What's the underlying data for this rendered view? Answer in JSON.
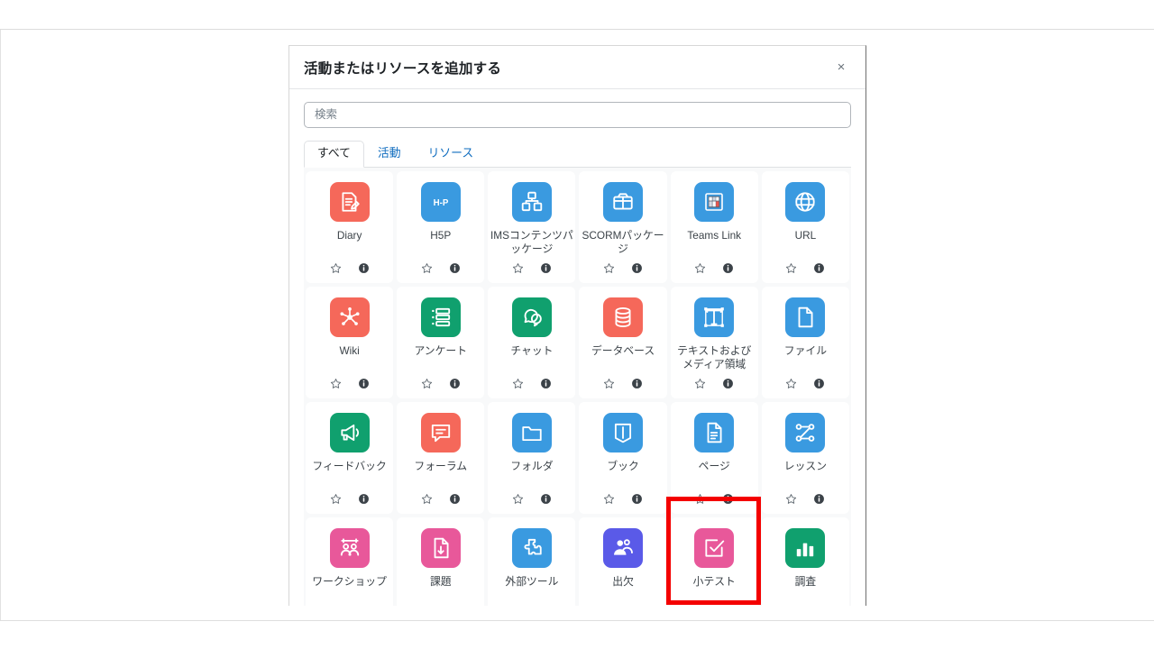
{
  "modal": {
    "title": "活動またはリソースを追加する",
    "close_label": "×",
    "close_icon": "close-icon"
  },
  "search": {
    "placeholder": "検索",
    "value": ""
  },
  "tabs": [
    {
      "label": "すべて",
      "active": true
    },
    {
      "label": "活動",
      "active": false
    },
    {
      "label": "リソース",
      "active": false
    }
  ],
  "card_actions": {
    "star_icon": "star-outline-icon",
    "info_icon": "info-circle-icon"
  },
  "colors": {
    "red": "#f5685a",
    "blue": "#3a9ae0",
    "green": "#10a06e",
    "pink": "#e8589a",
    "purple": "#5a5ae8",
    "highlight": "#f40000",
    "link": "#0f6cbf",
    "text": "#3b4248"
  },
  "items": [
    {
      "label": "Diary",
      "icon": "diary-icon",
      "color": "#f5685a"
    },
    {
      "label": "H5P",
      "icon": "h5p-icon",
      "color": "#3a9ae0"
    },
    {
      "label": "IMSコンテンツパッケージ",
      "icon": "ims-package-icon",
      "color": "#3a9ae0"
    },
    {
      "label": "SCORMパッケージ",
      "icon": "scorm-package-icon",
      "color": "#3a9ae0"
    },
    {
      "label": "Teams Link",
      "icon": "teams-link-icon",
      "color": "#3a9ae0"
    },
    {
      "label": "URL",
      "icon": "url-globe-icon",
      "color": "#3a9ae0"
    },
    {
      "label": "Wiki",
      "icon": "wiki-icon",
      "color": "#f5685a"
    },
    {
      "label": "アンケート",
      "icon": "questionnaire-icon",
      "color": "#10a06e"
    },
    {
      "label": "チャット",
      "icon": "chat-icon",
      "color": "#10a06e"
    },
    {
      "label": "データベース",
      "icon": "database-icon",
      "color": "#f5685a"
    },
    {
      "label": "テキストおよびメディア領域",
      "icon": "text-media-icon",
      "color": "#3a9ae0"
    },
    {
      "label": "ファイル",
      "icon": "file-icon",
      "color": "#3a9ae0"
    },
    {
      "label": "フィードバック",
      "icon": "feedback-icon",
      "color": "#10a06e"
    },
    {
      "label": "フォーラム",
      "icon": "forum-icon",
      "color": "#f5685a"
    },
    {
      "label": "フォルダ",
      "icon": "folder-icon",
      "color": "#3a9ae0"
    },
    {
      "label": "ブック",
      "icon": "book-icon",
      "color": "#3a9ae0"
    },
    {
      "label": "ページ",
      "icon": "page-icon",
      "color": "#3a9ae0"
    },
    {
      "label": "レッスン",
      "icon": "lesson-icon",
      "color": "#3a9ae0"
    },
    {
      "label": "ワークショップ",
      "icon": "workshop-icon",
      "color": "#e8589a"
    },
    {
      "label": "課題",
      "icon": "assignment-icon",
      "color": "#e8589a"
    },
    {
      "label": "外部ツール",
      "icon": "external-tool-icon",
      "color": "#3a9ae0"
    },
    {
      "label": "出欠",
      "icon": "attendance-icon",
      "color": "#5a5ae8"
    },
    {
      "label": "小テスト",
      "icon": "quiz-icon",
      "color": "#e8589a",
      "highlighted": true
    },
    {
      "label": "調査",
      "icon": "survey-icon",
      "color": "#10a06e"
    }
  ]
}
